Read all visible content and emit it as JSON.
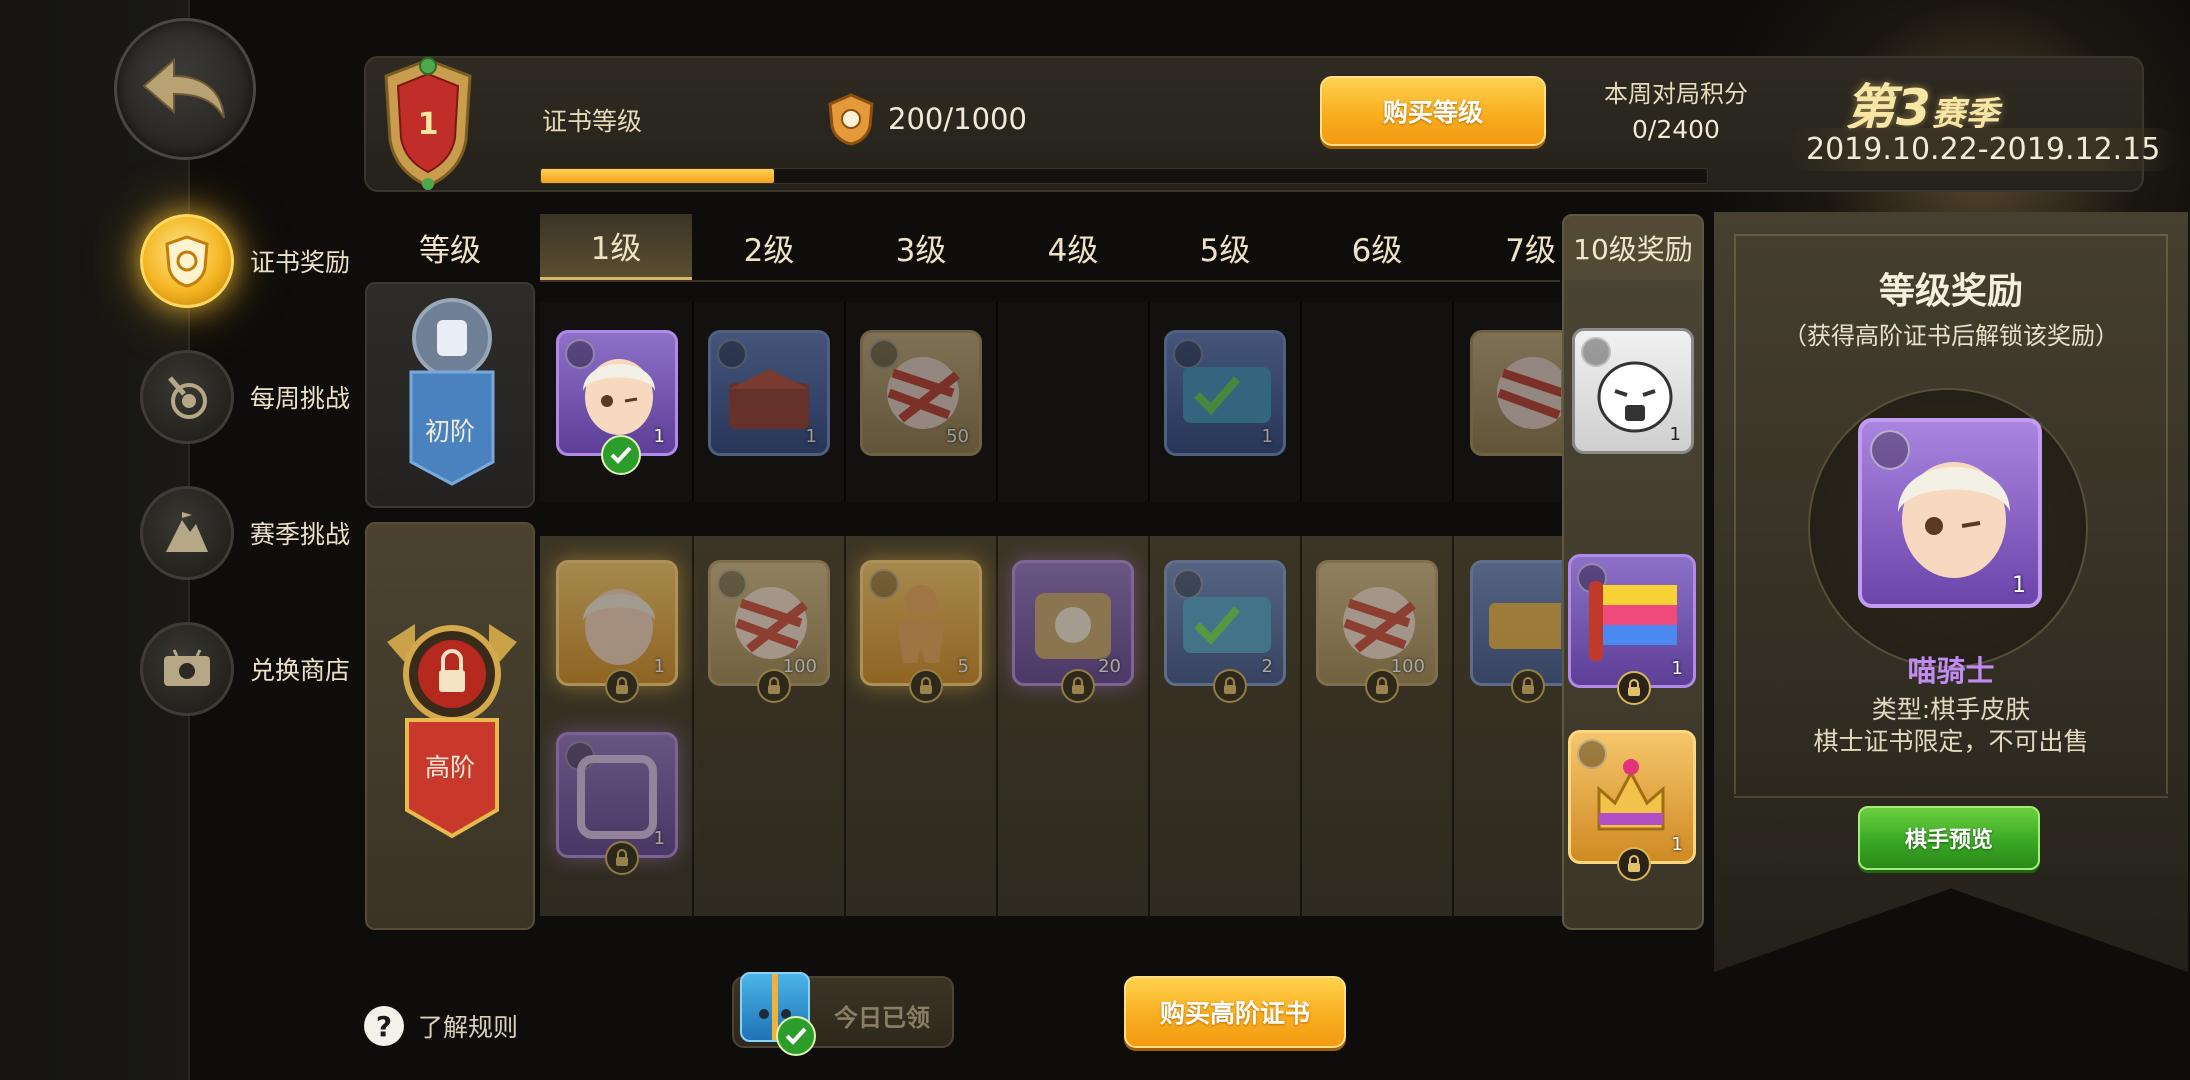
{
  "nav": {
    "items": [
      {
        "label": "证书奖励",
        "icon": "certificate-shield-icon",
        "active": true
      },
      {
        "label": "每周挑战",
        "icon": "target-hand-icon",
        "active": false
      },
      {
        "label": "赛季挑战",
        "icon": "mountain-flag-icon",
        "active": false
      },
      {
        "label": "兑换商店",
        "icon": "ticket-shop-icon",
        "active": false
      }
    ]
  },
  "header": {
    "rank": "1",
    "cert_label": "证书等级",
    "exp_text": "200/1000",
    "exp_progress": 0.2,
    "buy_level_label": "购买等级",
    "weekly_title": "本周对局积分",
    "weekly_value": "0/2400",
    "season_prefix": "第",
    "season_number": "3",
    "season_suffix": "赛季",
    "season_dates": "2019.10.22-2019.12.15"
  },
  "grid": {
    "level_col_label": "等级",
    "levels": [
      "1级",
      "2级",
      "3级",
      "4级",
      "5级",
      "6级",
      "7级"
    ],
    "level10_label": "10级奖励",
    "free_tier_label": "初阶",
    "paid_tier_label": "高阶",
    "free_rewards": [
      {
        "level": "1级",
        "qty": "1",
        "kind": "purple",
        "claimed": true
      },
      {
        "level": "2级",
        "qty": "1",
        "kind": "blue",
        "claimed": false
      },
      {
        "level": "3级",
        "qty": "50",
        "kind": "gold",
        "claimed": false
      },
      {
        "level": "5级",
        "qty": "1",
        "kind": "blue",
        "claimed": false
      },
      {
        "level": "7级",
        "qty": "",
        "kind": "gold",
        "claimed": false
      }
    ],
    "paid_rewards": [
      {
        "level": "1级",
        "qty": "1",
        "kind": "orange"
      },
      {
        "level": "2级",
        "qty": "100",
        "kind": "gold"
      },
      {
        "level": "3级",
        "qty": "5",
        "kind": "orange"
      },
      {
        "level": "4级",
        "qty": "20",
        "kind": "purple"
      },
      {
        "level": "5级",
        "qty": "2",
        "kind": "blue"
      },
      {
        "level": "6级",
        "qty": "100",
        "kind": "gold"
      },
      {
        "level": "7级",
        "qty": "",
        "kind": "blue"
      },
      {
        "level": "1级",
        "qty": "1",
        "kind": "purple"
      }
    ],
    "level10_free_qty": "1",
    "level10_paid": [
      {
        "qty": "1"
      },
      {
        "qty": "1"
      }
    ]
  },
  "detail": {
    "title": "等级奖励",
    "subtitle": "（获得高阶证书后解锁该奖励）",
    "reward_qty": "1",
    "name": "喵骑士",
    "type": "类型:棋手皮肤",
    "note": "棋士证书限定，不可出售",
    "preview_label": "棋手预览"
  },
  "footer": {
    "rules_label": "了解规则",
    "daily_label": "今日已领",
    "buy_premium_label": "购买高阶证书"
  },
  "colors": {
    "accent_gold": "#f8ae1f",
    "progress": "#ffcf55",
    "green_button": "#37a522",
    "purple_name": "#c08cf2"
  }
}
